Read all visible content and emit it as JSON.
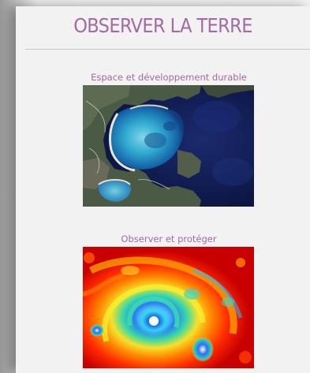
{
  "page": {
    "title": "OBSERVER LA TERRE"
  },
  "cards": [
    {
      "label": "Espace et développement durable",
      "image": "satellite-coastline-image"
    },
    {
      "label": "Observer et protéger",
      "image": "hurricane-thermal-image"
    }
  ],
  "colors": {
    "accent": "#a46aa2",
    "panel": "#f2f2f2",
    "divider": "#c9c9c9"
  }
}
